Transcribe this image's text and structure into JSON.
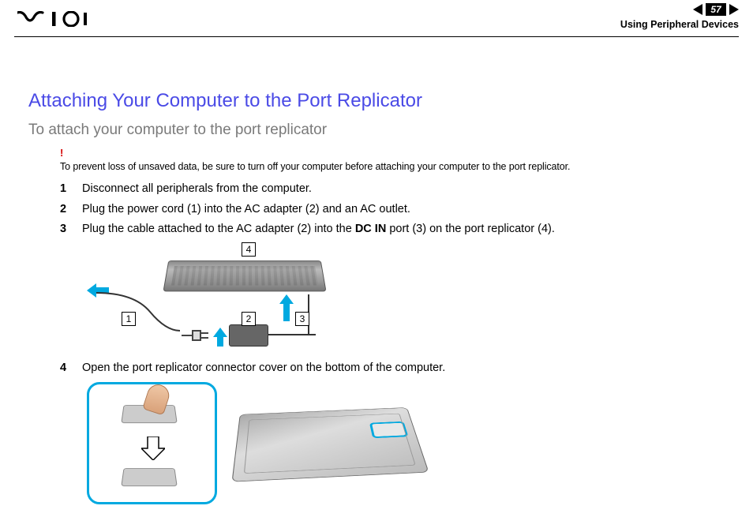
{
  "header": {
    "page_number": "57",
    "section_label": "Using Peripheral Devices"
  },
  "content": {
    "title": "Attaching Your Computer to the Port Replicator",
    "subtitle": "To attach your computer to the port replicator",
    "warning_mark": "!",
    "warning_text": "To prevent loss of unsaved data, be sure to turn off your computer before attaching your computer to the port replicator.",
    "steps": [
      {
        "num": "1",
        "text": "Disconnect all peripherals from the computer."
      },
      {
        "num": "2",
        "text": "Plug the power cord (1) into the AC adapter (2) and an AC outlet."
      },
      {
        "num": "3",
        "text_before": "Plug the cable attached to the AC adapter (2) into the ",
        "bold": "DC IN",
        "text_after": " port (3) on the port replicator (4)."
      },
      {
        "num": "4",
        "text": "Open the port replicator connector cover on the bottom of the computer."
      }
    ],
    "figure1_callouts": {
      "c1": "1",
      "c2": "2",
      "c3": "3",
      "c4": "4"
    }
  }
}
